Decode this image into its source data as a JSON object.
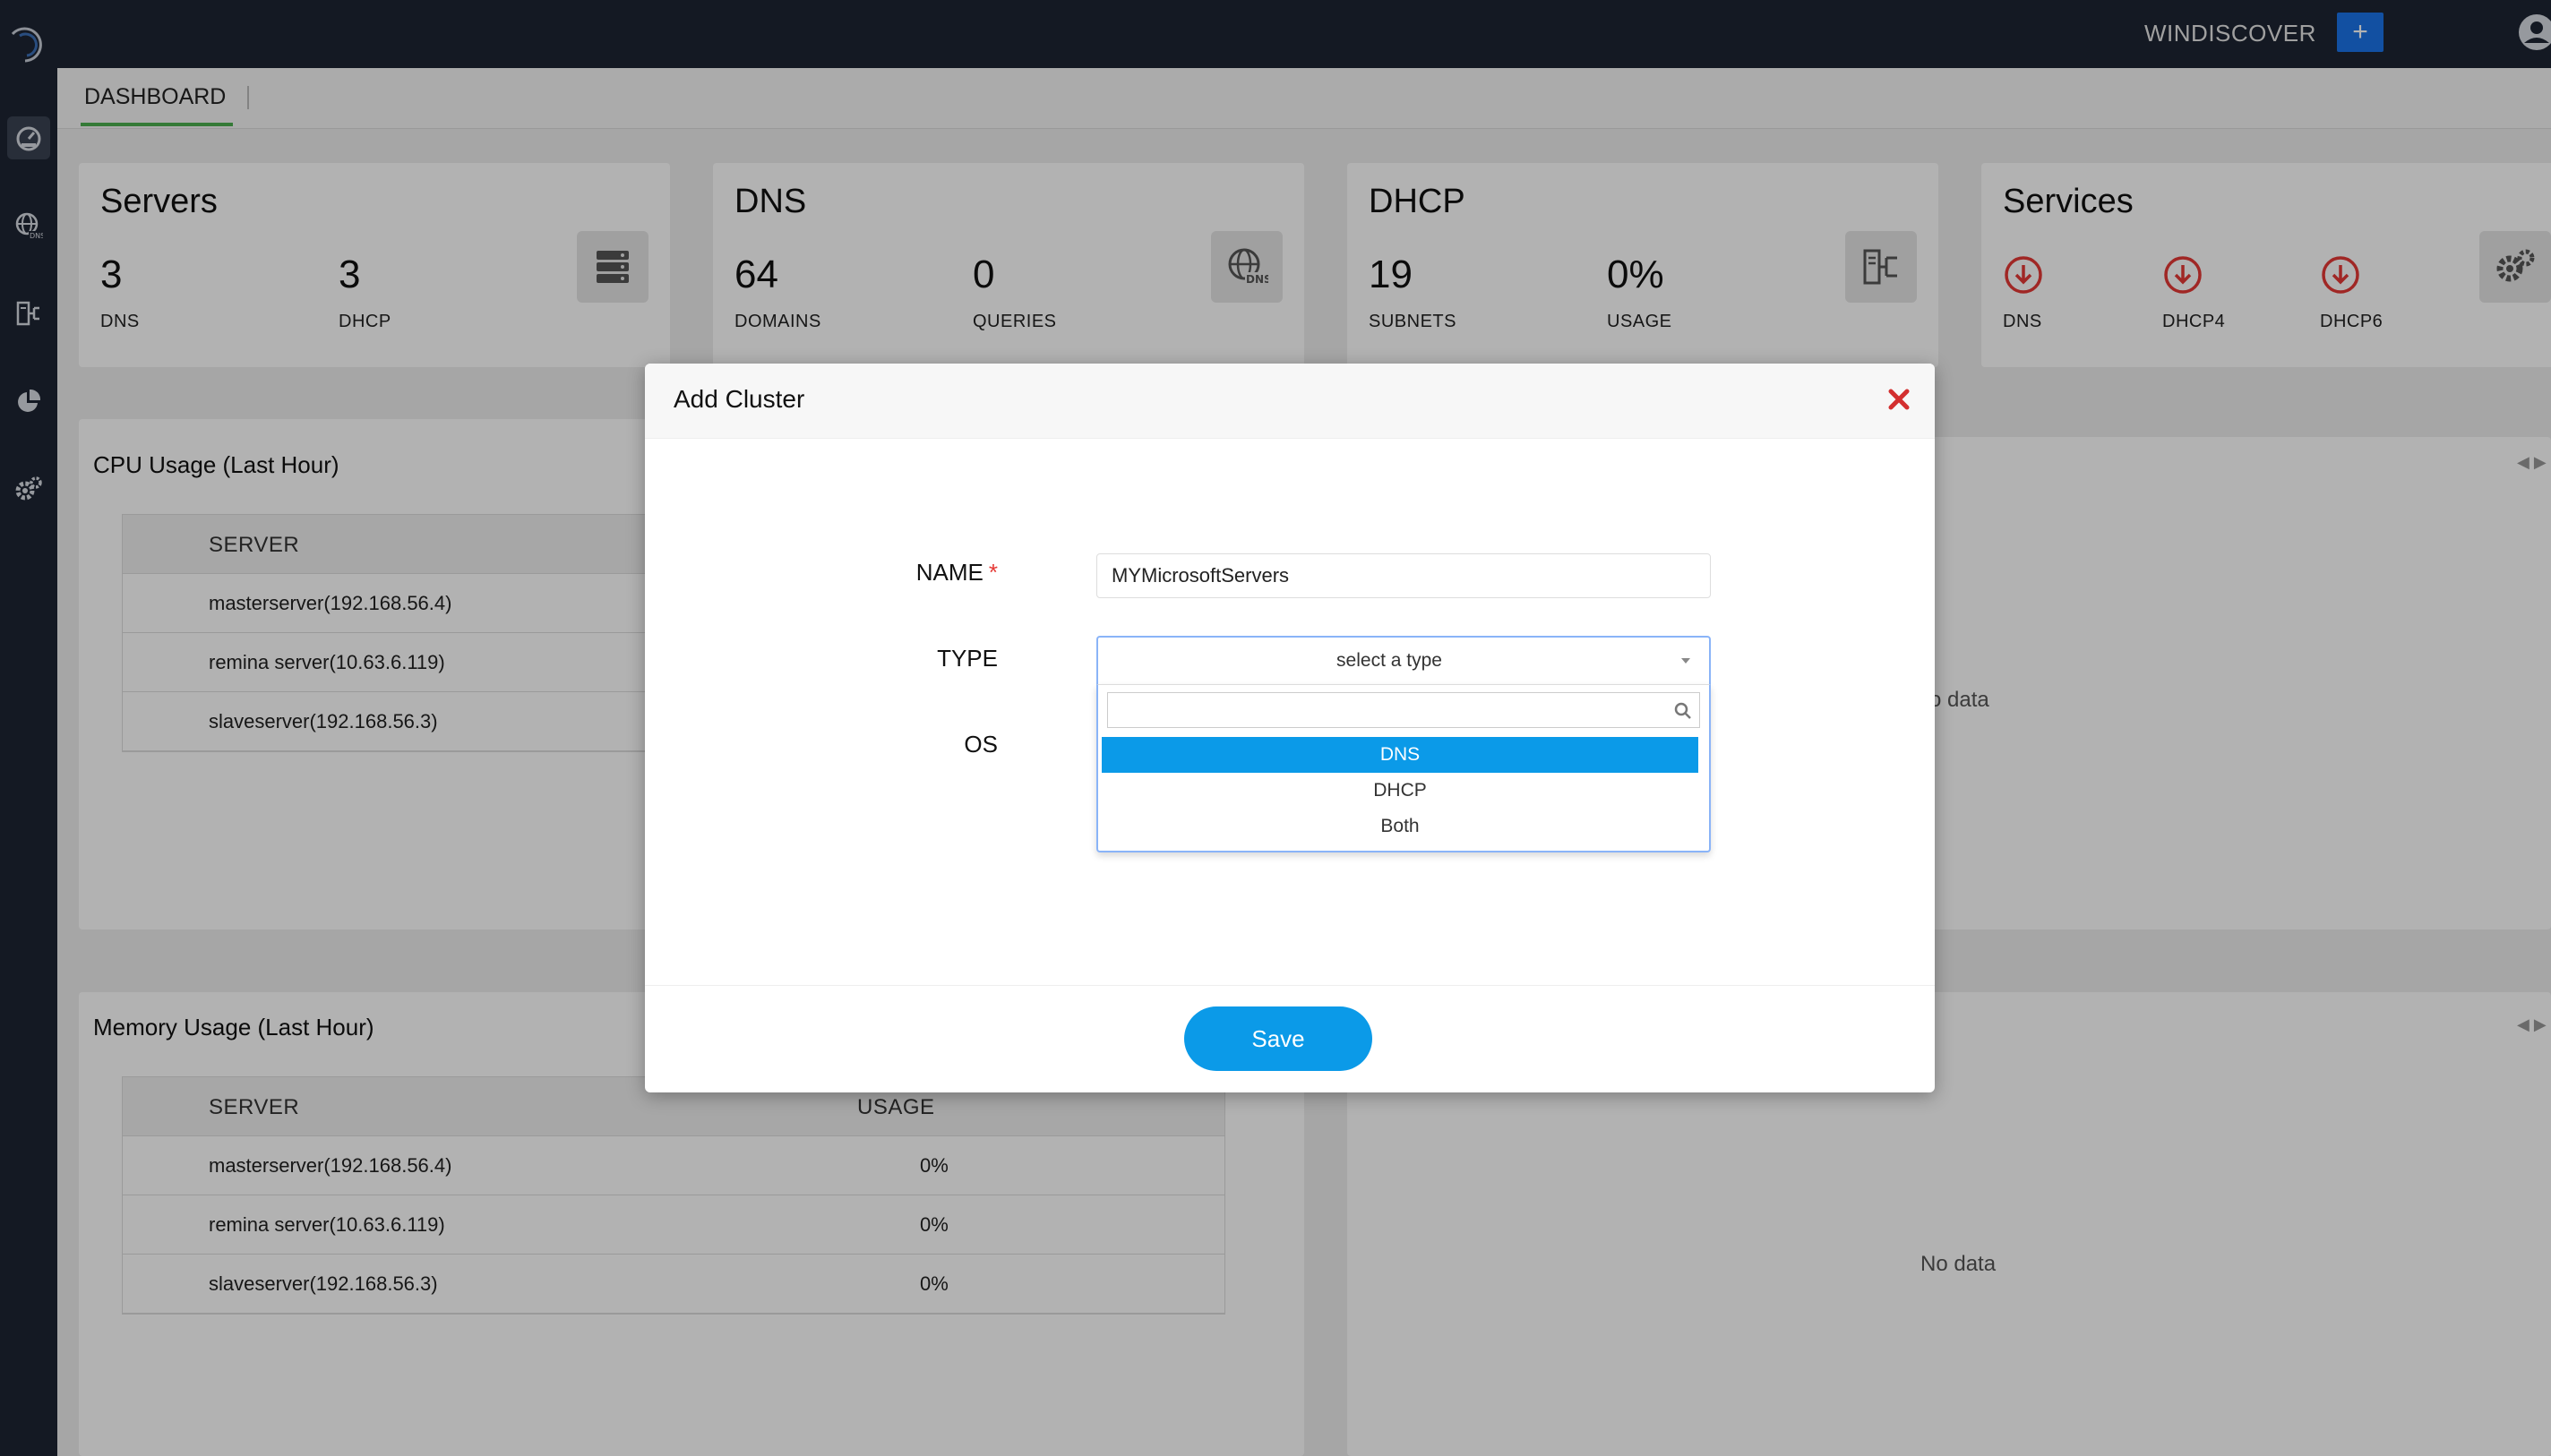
{
  "topbar": {
    "brand": "WINDISCOVER",
    "add_label": "+"
  },
  "tabs": [
    {
      "label": "DASHBOARD"
    }
  ],
  "cards": {
    "servers": {
      "title": "Servers",
      "stats": [
        {
          "value": "3",
          "label": "DNS"
        },
        {
          "value": "3",
          "label": "DHCP"
        }
      ]
    },
    "dns": {
      "title": "DNS",
      "stats": [
        {
          "value": "64",
          "label": "DOMAINS"
        },
        {
          "value": "0",
          "label": "QUERIES"
        }
      ]
    },
    "dhcp": {
      "title": "DHCP",
      "stats": [
        {
          "value": "19",
          "label": "SUBNETS"
        },
        {
          "value": "0%",
          "label": "USAGE"
        }
      ]
    },
    "services": {
      "title": "Services",
      "items": [
        {
          "label": "DNS"
        },
        {
          "label": "DHCP4"
        },
        {
          "label": "DHCP6"
        }
      ],
      "status_color": "#e53935"
    }
  },
  "cpu_panel": {
    "title": "CPU Usage (Last Hour)",
    "columns": [
      "SERVER"
    ],
    "rows": [
      "masterserver(192.168.56.4)",
      "remina server(10.63.6.119)",
      "slaveserver(192.168.56.3)"
    ],
    "side_text": "o data"
  },
  "memory_panel": {
    "title": "Memory Usage (Last Hour)",
    "columns": [
      "SERVER",
      "USAGE"
    ],
    "rows": [
      {
        "server": "masterserver(192.168.56.4)",
        "usage": "0%"
      },
      {
        "server": "remina server(10.63.6.119)",
        "usage": "0%"
      },
      {
        "server": "slaveserver(192.168.56.3)",
        "usage": "0%"
      }
    ],
    "side_text": "No data"
  },
  "modal": {
    "title": "Add Cluster",
    "name_label": "NAME",
    "required_mark": "*",
    "name_value": "MYMicrosoftServers",
    "type_label": "TYPE",
    "type_placeholder": "select a type",
    "os_label": "OS",
    "options": [
      "DNS",
      "DHCP",
      "Both"
    ],
    "save_label": "Save"
  },
  "colors": {
    "topbar": "#1e2533",
    "accent": "#0b9ae8",
    "brand_button": "#1a73e8",
    "tab_underline": "#4caf50",
    "close": "#d32f2f"
  }
}
